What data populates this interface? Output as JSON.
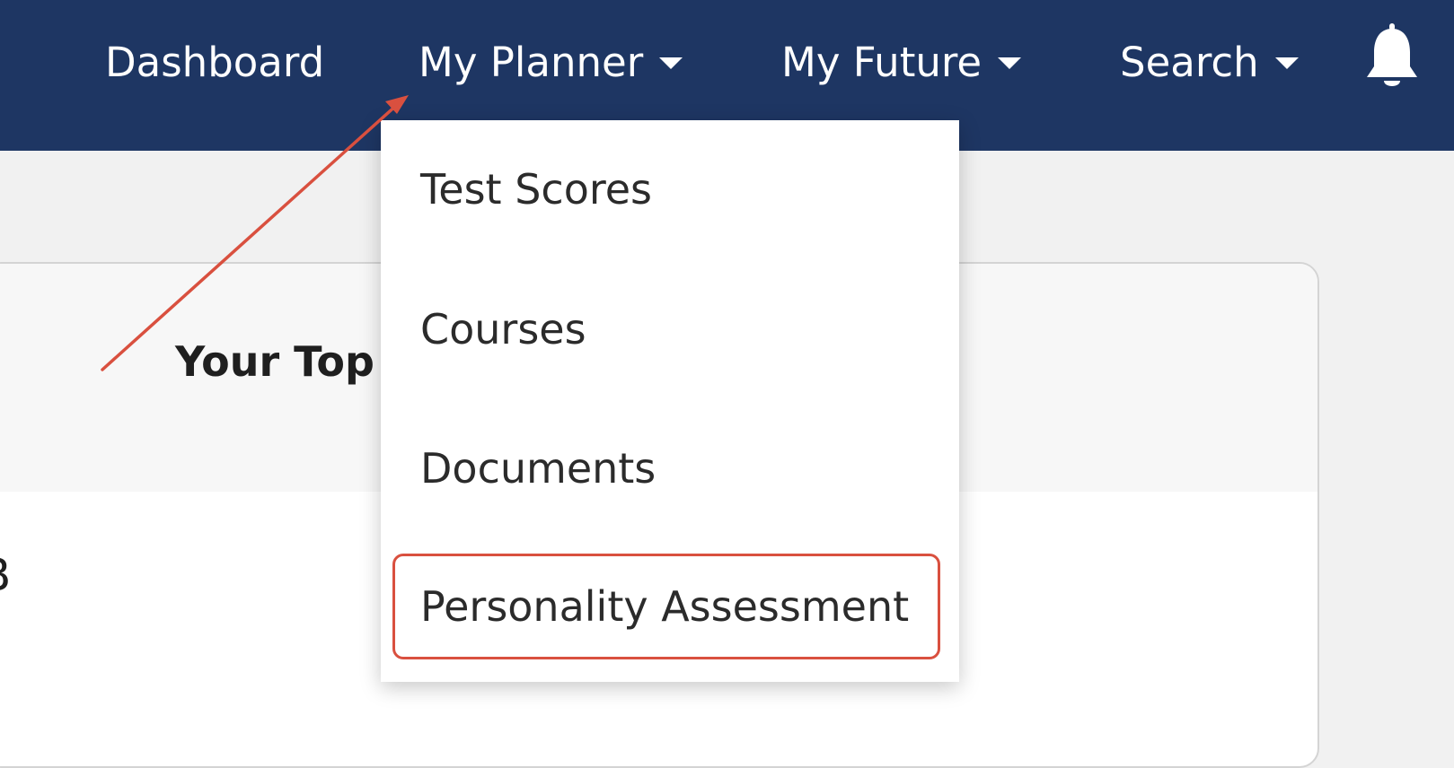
{
  "nav": {
    "items": [
      {
        "label": "Dashboard",
        "has_dropdown": false
      },
      {
        "label": "My Planner",
        "has_dropdown": true
      },
      {
        "label": "My Future",
        "has_dropdown": true
      },
      {
        "label": "Search",
        "has_dropdown": true
      }
    ],
    "icon": "bell-icon"
  },
  "dropdown": {
    "items": [
      {
        "label": "Test Scores"
      },
      {
        "label": "Courses"
      },
      {
        "label": "Documents"
      },
      {
        "label": "Personality Assessment",
        "highlighted": true
      }
    ]
  },
  "card": {
    "title": "Your Top",
    "body_text": "B"
  },
  "colors": {
    "navbar": "#1e3663",
    "annotation": "#d9503f"
  }
}
